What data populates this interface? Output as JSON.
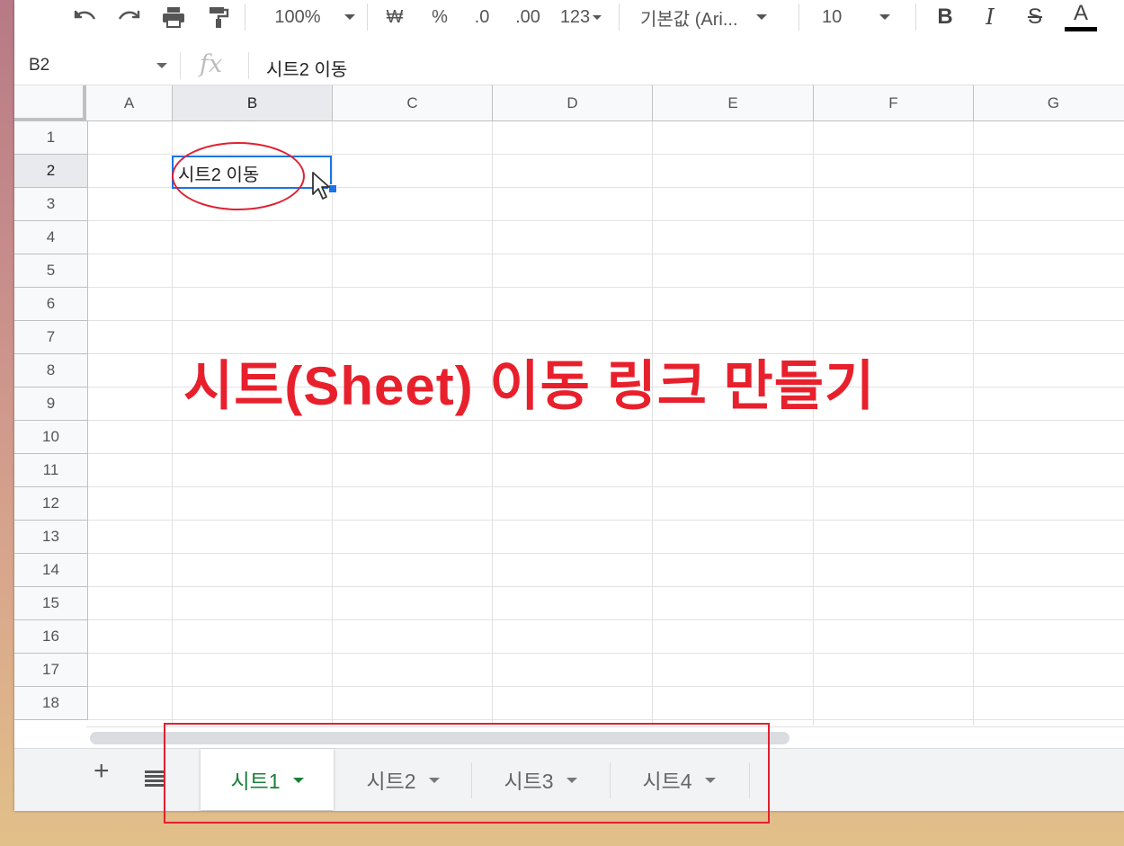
{
  "toolbar": {
    "zoom": "100%",
    "currency": "₩",
    "percent": "%",
    "decrease_decimal": ".0",
    "increase_decimal": ".00",
    "number_format": "123",
    "font_family": "기본값 (Ari...",
    "font_size": "10",
    "bold": "B",
    "italic": "I",
    "strike": "S",
    "text_color": "A"
  },
  "formula_bar": {
    "cell_ref": "B2",
    "fx": "fx",
    "content": "시트2 이동"
  },
  "grid": {
    "columns": [
      "A",
      "B",
      "C",
      "D",
      "E",
      "F",
      "G"
    ],
    "rows": [
      "1",
      "2",
      "3",
      "4",
      "5",
      "6",
      "7",
      "8",
      "9",
      "10",
      "11",
      "12",
      "13",
      "14",
      "15",
      "16",
      "17",
      "18"
    ],
    "selected_cell": "B2",
    "cell_b2_value": "시트2 이동"
  },
  "annotation": "시트(Sheet) 이동 링크 만들기",
  "sheets": {
    "tabs": [
      {
        "label": "시트1",
        "active": true
      },
      {
        "label": "시트2",
        "active": false
      },
      {
        "label": "시트3",
        "active": false
      },
      {
        "label": "시트4",
        "active": false
      }
    ]
  },
  "colors": {
    "selection": "#1a73e8",
    "active_tab": "#188038",
    "annotation_red": "#e8202c"
  }
}
